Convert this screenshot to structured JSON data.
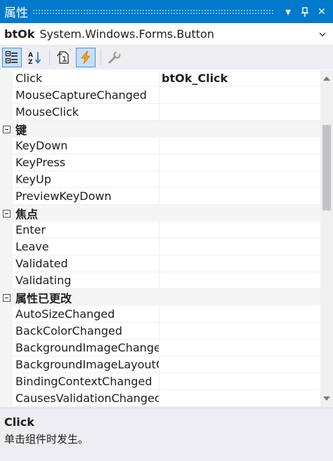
{
  "window": {
    "title": "属性",
    "dropdown_glyph": "▾",
    "pin_glyph": "ᚋ",
    "close_glyph": "✕"
  },
  "object_selector": {
    "name": "btOk",
    "type": "System.Windows.Forms.Button"
  },
  "toolbar": {
    "tools": [
      {
        "name": "categorized-icon",
        "active": true
      },
      {
        "name": "alphabetical-icon",
        "active": false
      },
      {
        "name": "properties-icon",
        "active": false
      },
      {
        "name": "events-icon",
        "active": true
      },
      {
        "name": "property-pages-icon",
        "active": false
      }
    ]
  },
  "grid": {
    "rows": [
      {
        "type": "prop",
        "name": "Click",
        "value": "btOk_Click"
      },
      {
        "type": "prop",
        "name": "MouseCaptureChanged",
        "value": ""
      },
      {
        "type": "prop",
        "name": "MouseClick",
        "value": ""
      },
      {
        "type": "cat",
        "name": "键"
      },
      {
        "type": "prop",
        "name": "KeyDown",
        "value": ""
      },
      {
        "type": "prop",
        "name": "KeyPress",
        "value": ""
      },
      {
        "type": "prop",
        "name": "KeyUp",
        "value": ""
      },
      {
        "type": "prop",
        "name": "PreviewKeyDown",
        "value": ""
      },
      {
        "type": "cat",
        "name": "焦点"
      },
      {
        "type": "prop",
        "name": "Enter",
        "value": ""
      },
      {
        "type": "prop",
        "name": "Leave",
        "value": ""
      },
      {
        "type": "prop",
        "name": "Validated",
        "value": ""
      },
      {
        "type": "prop",
        "name": "Validating",
        "value": ""
      },
      {
        "type": "cat",
        "name": "属性已更改"
      },
      {
        "type": "prop",
        "name": "AutoSizeChanged",
        "value": ""
      },
      {
        "type": "prop",
        "name": "BackColorChanged",
        "value": ""
      },
      {
        "type": "prop",
        "name": "BackgroundImageChange",
        "value": ""
      },
      {
        "type": "prop",
        "name": "BackgroundImageLayoutC",
        "value": ""
      },
      {
        "type": "prop",
        "name": "BindingContextChanged",
        "value": ""
      },
      {
        "type": "prop",
        "name": "CausesValidationChangec",
        "value": ""
      }
    ]
  },
  "description": {
    "title": "Click",
    "text": "单击组件时发生。"
  },
  "colors": {
    "accent": "#007acc",
    "active_tool_bg": "#c9def5",
    "active_tool_border": "#3399ff",
    "events_icon": "#f0a30a"
  }
}
